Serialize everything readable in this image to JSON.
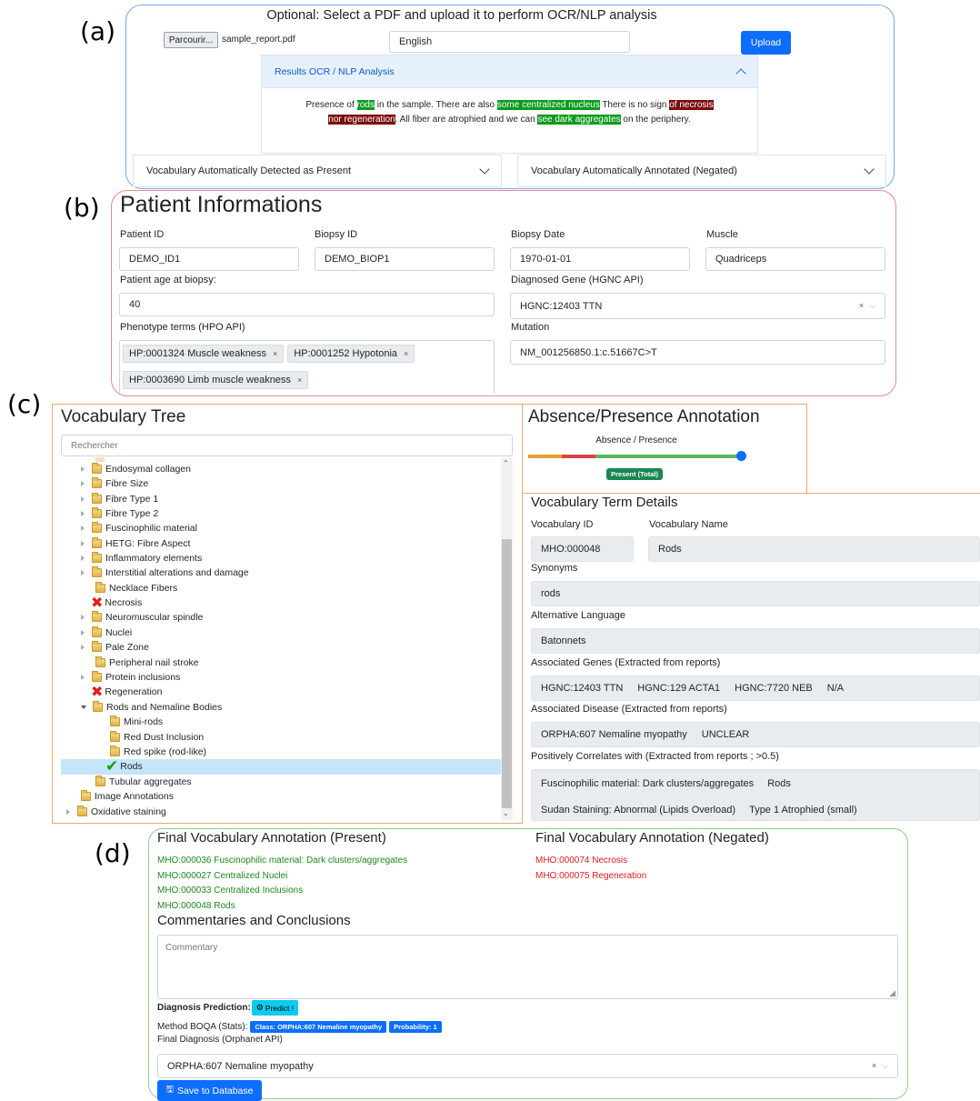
{
  "labels": {
    "a": "(a)",
    "b": "(b)",
    "c": "(c)",
    "d": "(d)"
  },
  "upload": {
    "title": "Optional: Select a PDF and upload it to perform OCR/NLP analysis",
    "browse_label": "Parcourir...",
    "file_name": "sample_report.pdf",
    "language": "English",
    "upload_label": "Upload",
    "results_title": "Results OCR / NLP Analysis",
    "text": {
      "p1": "Presence of ",
      "h1": "rods",
      "p2": " in the sample. There are also ",
      "h2": "some centralized nucleus",
      "p3": " There is no sign ",
      "h3": "of necrosis",
      "h4": "nor regeneration",
      "p4": ". All fiber are atrophied and we can ",
      "h5": "see dark aggregates",
      "p5": " on the periphery."
    },
    "acc_present": "Vocabulary Automatically Detected as Present",
    "acc_negated": "Vocabulary Automatically Annotated (Negated)"
  },
  "patient": {
    "title": "Patient Informations",
    "patient_id_label": "Patient ID",
    "patient_id": "DEMO_ID1",
    "biopsy_id_label": "Biopsy ID",
    "biopsy_id": "DEMO_BIOP1",
    "biopsy_date_label": "Biopsy Date",
    "biopsy_date": "1970-01-01",
    "muscle_label": "Muscle",
    "muscle": "Quadriceps",
    "age_label": "Patient age at biopsy:",
    "age": "40",
    "gene_label": "Diagnosed Gene (HGNC API)",
    "gene": "HGNC:12403 TTN",
    "phenotype_label": "Phenotype terms (HPO API)",
    "phenotypes": [
      "HP:0001324 Muscle weakness",
      "HP:0001252 Hypotonia",
      "HP:0003690 Limb muscle weakness"
    ],
    "mutation_label": "Mutation",
    "mutation": "NM_001256850.1:c.51667C>T"
  },
  "tree": {
    "title": "Vocabulary Tree",
    "search_placeholder": "Rechercher",
    "items": [
      "Endosymal collagen",
      "Fibre Size",
      "Fibre Type 1",
      "Fibre Type 2",
      "Fuscinophilic material",
      "HETG: Fibre Aspect",
      "Inflammatory elements",
      "Interstitial alterations and damage",
      "Necklace Fibers",
      "Necrosis",
      "Neuromuscular spindle",
      "Nuclei",
      "Pale Zone",
      "Peripheral nail stroke",
      "Protein inclusions",
      "Regeneration",
      "Rods and Nemaline Bodies",
      "Mini-rods",
      "Red Dust Inclusion",
      "Red spike (rod-like)",
      "Rods",
      "Tubular aggregates",
      "Image Annotations",
      "Oxidative staining"
    ]
  },
  "annotation": {
    "title": "Absence/Presence Annotation",
    "slider_label": "Absence / Presence",
    "slider_value": 1.0,
    "badge": "Present (Total)"
  },
  "details": {
    "title": "Vocabulary Term Details",
    "vocab_id_label": "Vocabulary ID",
    "vocab_id": "MHO:000048",
    "vocab_name_label": "Vocabulary Name",
    "vocab_name": "Rods",
    "synonyms_label": "Synonyms",
    "synonyms": "rods",
    "alt_lang_label": "Alternative Language",
    "alt_lang": "Batonnets",
    "genes_label": "Associated Genes (Extracted from reports)",
    "genes": [
      "HGNC:12403 TTN",
      "HGNC:129 ACTA1",
      "HGNC:7720 NEB",
      "N/A"
    ],
    "disease_label": "Associated Disease (Extracted from reports)",
    "diseases": [
      "ORPHA:607 Nemaline myopathy",
      "UNCLEAR"
    ],
    "correlates_label": "Positively Correlates with (Extracted from reports ; >0.5)",
    "correlates_row1": [
      "Fuscinophilic material: Dark clusters/aggregates",
      "Rods"
    ],
    "correlates_row2": [
      "Sudan Staining: Abnormal (Lipids Overload)",
      "Type 1 Atrophied (small)"
    ]
  },
  "final": {
    "present_title": "Final Vocabulary Annotation (Present)",
    "present": [
      "MHO:000036 Fuscinophilic material: Dark clusters/aggregates",
      "MHO:000027 Centralized Nuclei",
      "MHO:000033 Centralized Inclusions",
      "MHO:000048 Rods"
    ],
    "negated_title": "Final Vocabulary Annotation (Negated)",
    "negated": [
      "MHO:000074 Necrosis",
      "MHO:000075 Regeneration"
    ],
    "comments_title": "Commentaries and Conclusions",
    "comment_placeholder": "Commentary",
    "prediction_label": "Diagnosis Prediction:",
    "predict_button": "Predict !",
    "method_label": "Method BOQA (Stats):",
    "class_badge": "Class: ORPHA:607 Nemaline myopathy",
    "prob_badge": "Probability: 1",
    "final_diag_label": "Final Diagnosis (Orphanet API)",
    "final_diag": "ORPHA:607 Nemaline myopathy",
    "save_label": "Save to Database"
  },
  "colors": {
    "blue_frame": "#7aa7e8",
    "red_frame": "#e58a8a",
    "orange_frame": "#f0a56a",
    "green_frame": "#8fd08f",
    "present_green": "#1c8a1c",
    "negated_red": "#e01b1b",
    "primary": "#0d6efd"
  }
}
